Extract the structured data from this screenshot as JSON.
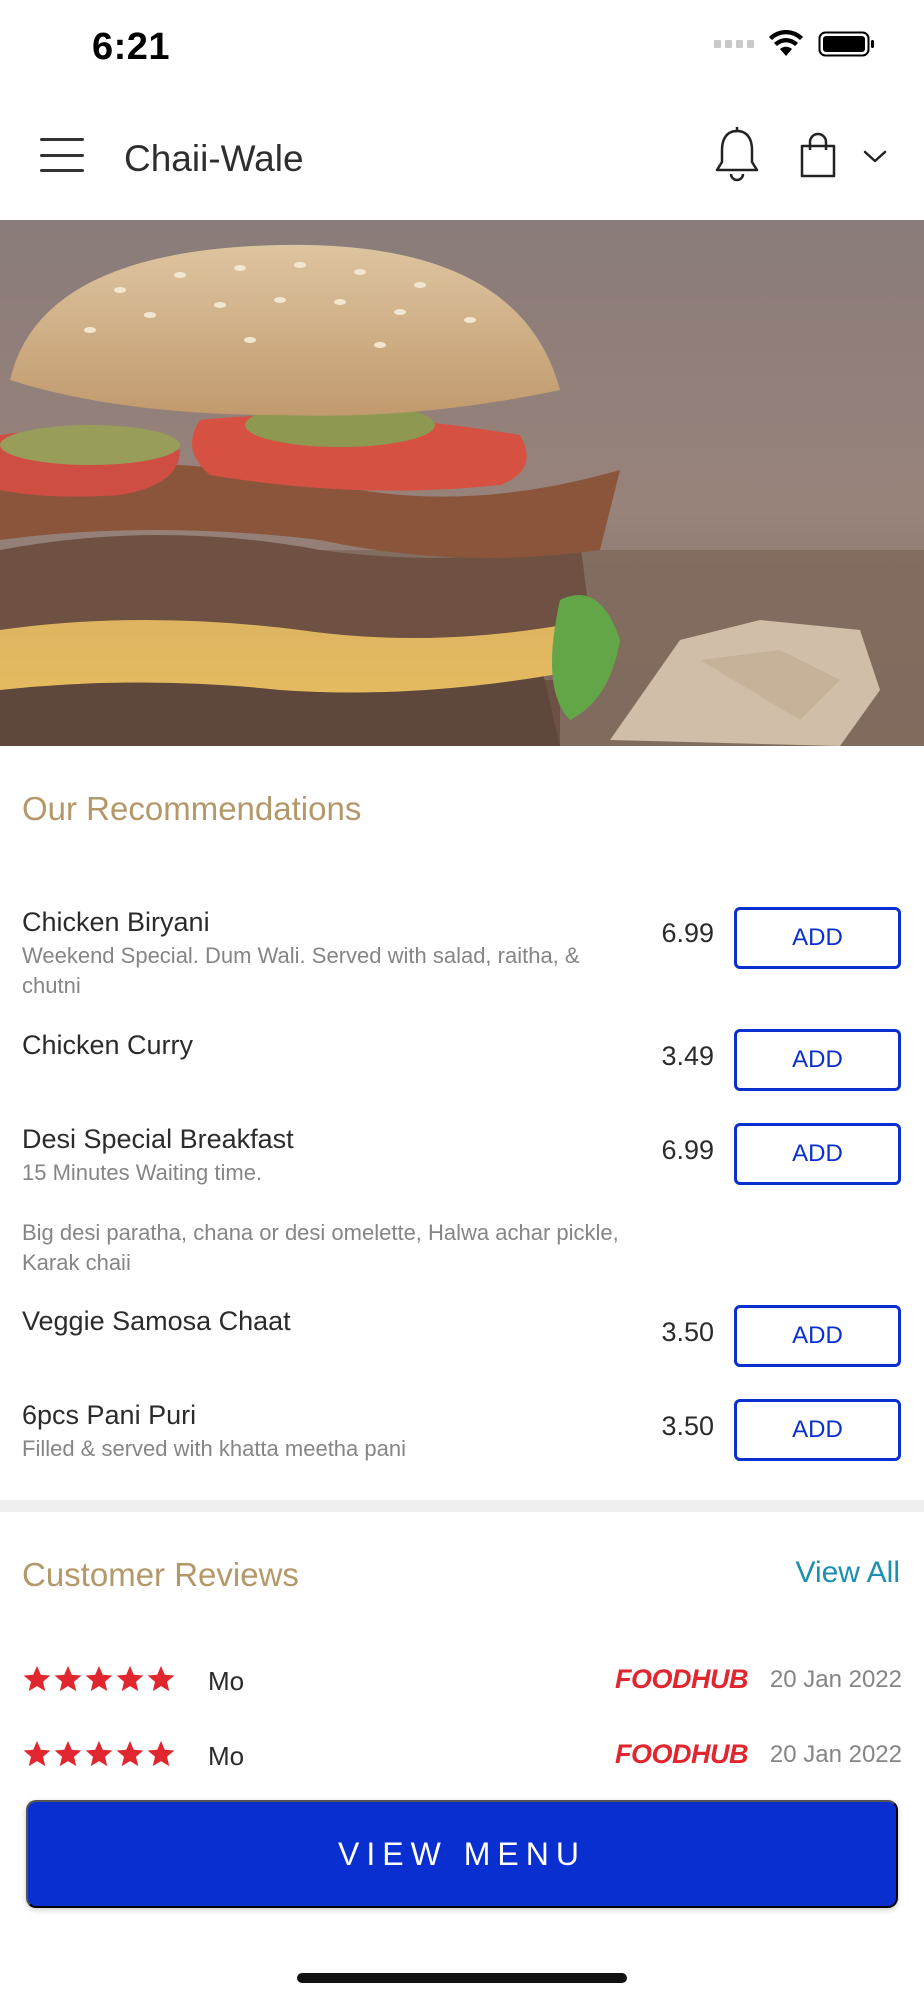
{
  "status_bar": {
    "time": "6:21"
  },
  "header": {
    "title": "Chaii-Wale",
    "icons": [
      "menu-icon",
      "bell-icon",
      "shopping-bag-icon",
      "chevron-down-icon"
    ]
  },
  "recommendations": {
    "title": "Our Recommendations",
    "add_label": "ADD",
    "items": [
      {
        "name": "Chicken Biryani",
        "description": "Weekend Special. Dum Wali. Served with salad, raitha, & chutni",
        "price": "6.99"
      },
      {
        "name": "Chicken Curry",
        "description": "",
        "price": "3.49"
      },
      {
        "name": "Desi Special Breakfast",
        "description": "15 Minutes Waiting time.",
        "description2": "Big desi paratha, chana or desi omelette, Halwa achar pickle, Karak chaii",
        "price": "6.99"
      },
      {
        "name": "Veggie Samosa Chaat",
        "description": "",
        "price": "3.50"
      },
      {
        "name": "6pcs Pani Puri",
        "description": "Filled & served with khatta meetha pani",
        "price": "3.50"
      }
    ]
  },
  "reviews": {
    "title": "Customer Reviews",
    "view_all": "View All",
    "items": [
      {
        "rating": 5,
        "name": "Mo",
        "source": "FOODHUB",
        "date": "20 Jan 2022"
      },
      {
        "rating": 5,
        "name": "Mo",
        "source": "FOODHUB",
        "date": "20 Jan 2022"
      }
    ]
  },
  "cta": {
    "label": "VIEW MENU"
  },
  "colors": {
    "accent_blue": "#0a2fd1",
    "section_title": "#b5986a",
    "link": "#1b8fb0",
    "star": "#e0262e"
  }
}
